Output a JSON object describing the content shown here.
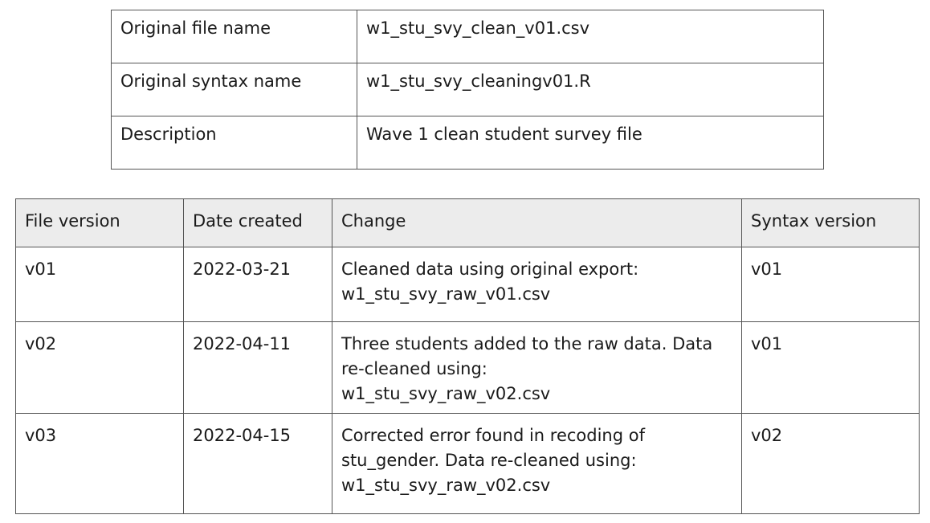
{
  "metadata": {
    "rows": [
      {
        "label": "Original file name",
        "value": "w1_stu_svy_clean_v01.csv"
      },
      {
        "label": "Original syntax name",
        "value": "w1_stu_svy_cleaningv01.R"
      },
      {
        "label": "Description",
        "value": "Wave 1 clean student survey file"
      }
    ]
  },
  "versions": {
    "headers": [
      "File version",
      "Date created",
      "Change",
      "Syntax version"
    ],
    "rows": [
      {
        "file_version": "v01",
        "date_created": "2022-03-21",
        "change_line1": "Cleaned data using original export:",
        "change_line2": "w1_stu_svy_raw_v01.csv",
        "change_line3": "",
        "syntax_version": "v01"
      },
      {
        "file_version": "v02",
        "date_created": "2022-04-11",
        "change_line1": "Three students added to the raw data. Data",
        "change_line2": "re-cleaned using:",
        "change_line3": "w1_stu_svy_raw_v02.csv",
        "syntax_version": "v01"
      },
      {
        "file_version": "v03",
        "date_created": "2022-04-15",
        "change_line1": "Corrected error found in recoding of",
        "change_line2": "stu_gender. Data re-cleaned using:",
        "change_line3": "w1_stu_svy_raw_v02.csv",
        "syntax_version": "v02"
      }
    ]
  }
}
